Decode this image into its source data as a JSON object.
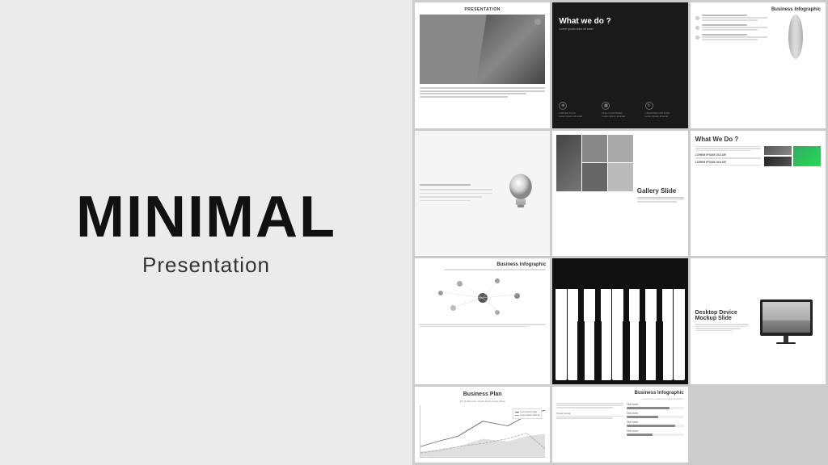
{
  "hero": {
    "title": "MINIMAL",
    "subtitle": "Presentation"
  },
  "slides": [
    {
      "id": 1,
      "label": "PRESENTATION",
      "type": "presentation-photo"
    },
    {
      "id": 2,
      "title": "What we do ?",
      "subtitle": "Lorem ipsum dolor sit amet consectetur",
      "type": "what-we-do-dark",
      "icons": [
        {
          "label": "LIMITED PLAN",
          "desc": "Lorem ipsum dolor sit amet"
        },
        {
          "label": "FULL CUSTOMAR",
          "desc": "Lorem ipsum dolor sit amet"
        },
        {
          "label": "UNLIMITED OPTIONS",
          "desc": "Lorem ipsum dolor sit amet"
        }
      ]
    },
    {
      "id": 3,
      "title": "Business Infographic",
      "type": "infographic-lens"
    },
    {
      "id": 4,
      "type": "lightbulb",
      "text": "sit amet, lacus nulla sit amet porttitor ligula ligula porttitor dolor,"
    },
    {
      "id": 5,
      "title": "Gallery Slide",
      "type": "gallery"
    },
    {
      "id": 6,
      "title": "What We Do ?",
      "type": "what-we-do-light",
      "labels": [
        "LOREM IPSUM DOLOR",
        "LOREM IPSUM DOLOR"
      ]
    },
    {
      "id": 7,
      "title": "Business Infographic",
      "type": "network"
    },
    {
      "id": 8,
      "type": "piano"
    },
    {
      "id": 9,
      "title": "Desktop Device Mockup Slide",
      "type": "desktop-mockup"
    },
    {
      "id": 10,
      "title": "Business Plan",
      "subtitle": "It's all about the simple facts people follow",
      "type": "chart"
    },
    {
      "id": 11,
      "title": "Business Infographic",
      "type": "progress-bars",
      "items": [
        {
          "label": "Text here",
          "pct": 75
        },
        {
          "label": "Text here",
          "pct": 55
        },
        {
          "label": "Text here",
          "pct": 85
        },
        {
          "label": "Text here",
          "pct": 45
        }
      ]
    }
  ]
}
